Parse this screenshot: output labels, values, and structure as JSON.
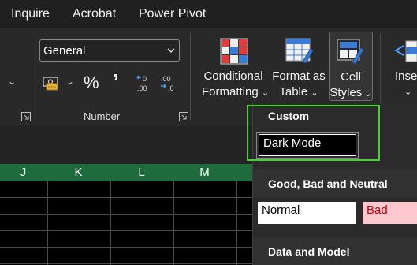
{
  "menu": {
    "tabs": [
      "Inquire",
      "Acrobat",
      "Power Pivot"
    ]
  },
  "ribbon": {
    "number_format": {
      "value": "General"
    },
    "currency_icon": "accounting-format-icon",
    "percent_symbol": "%",
    "comma_symbol": "̕",
    "number_group_label": "Number",
    "conditional_formatting": {
      "line1": "Conditional",
      "line2": "Formatting"
    },
    "format_as_table": {
      "line1": "Format as",
      "line2": "Table"
    },
    "cell_styles": {
      "line1": "Cell",
      "line2": "Styles"
    },
    "insert": {
      "line1": "Inse"
    }
  },
  "grid": {
    "columns": [
      "J",
      "K",
      "L",
      "M"
    ]
  },
  "gallery": {
    "custom": {
      "title": "Custom",
      "styles": [
        "Dark Mode"
      ]
    },
    "good_bad_neutral": {
      "title": "Good, Bad and Neutral",
      "styles": [
        "Normal",
        "Bad"
      ]
    },
    "data_model": {
      "title": "Data and Model"
    }
  },
  "colors": {
    "header_green": "#1e6b3c",
    "highlight_green": "#44d32e",
    "bad_fill": "#ffc7ce",
    "bad_text": "#c00006"
  }
}
